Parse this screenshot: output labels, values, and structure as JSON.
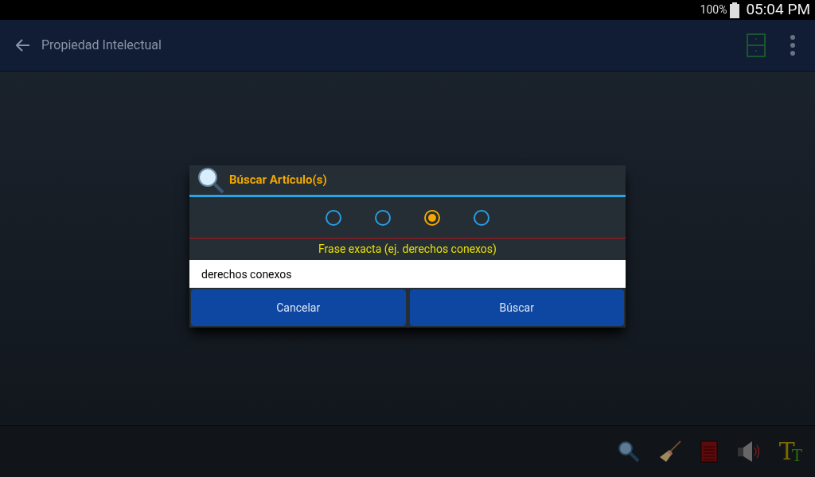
{
  "status_bar": {
    "battery": "100%",
    "time": "05:04 PM"
  },
  "app_bar": {
    "title": "Propiedad Intelectual"
  },
  "dialog": {
    "title": "Búscar Artículo(s)",
    "options": [
      {
        "selected": false
      },
      {
        "selected": false
      },
      {
        "selected": true
      },
      {
        "selected": false
      }
    ],
    "hint": "Frase exacta (ej. derechos conexos)",
    "query": "derechos conexos",
    "buttons": [
      "Cancelar",
      "Búscar"
    ]
  },
  "toolbar": [
    {
      "kind": "search"
    },
    {
      "kind": "broom"
    },
    {
      "kind": "notepad"
    },
    {
      "kind": "speaker"
    },
    {
      "kind": "font",
      "letters": [
        "T",
        "T"
      ]
    }
  ]
}
